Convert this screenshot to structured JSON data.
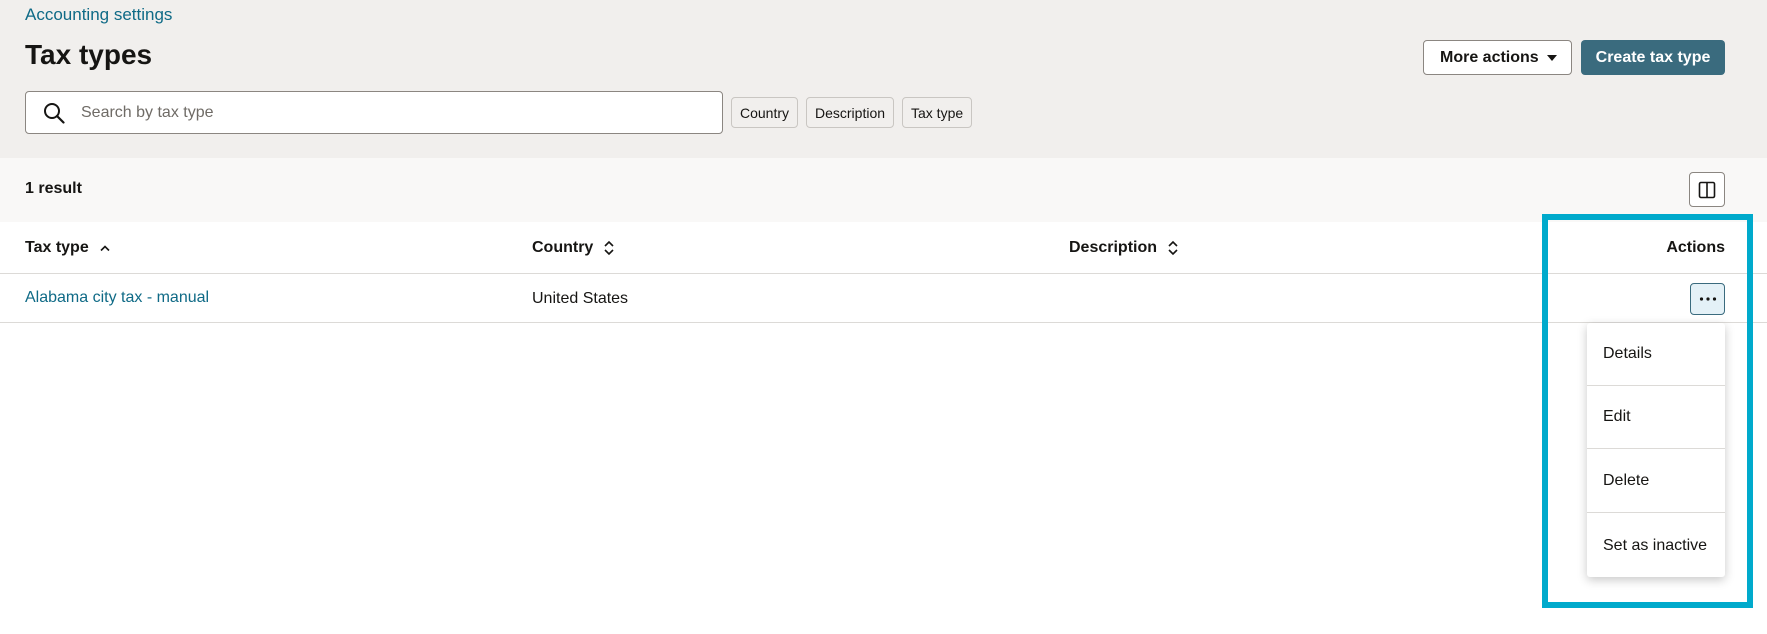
{
  "breadcrumb": "Accounting settings",
  "page_title": "Tax types",
  "header_actions": {
    "more_actions": "More actions",
    "create": "Create tax type"
  },
  "search": {
    "placeholder": "Search by tax type",
    "value": ""
  },
  "filter_chips": [
    "Country",
    "Description",
    "Tax type"
  ],
  "results": {
    "count_label": "1 result"
  },
  "table": {
    "columns": [
      "Tax type",
      "Country",
      "Description",
      "Actions"
    ],
    "rows": [
      {
        "tax_type": "Alabama city tax - manual",
        "country": "United States",
        "description": ""
      }
    ]
  },
  "row_menu": {
    "items": [
      "Details",
      "Edit",
      "Delete",
      "Set as inactive"
    ]
  },
  "colors": {
    "accent": "#3a6b7e",
    "link": "#0f6a86",
    "highlight": "#00aacc",
    "header_bg": "#f1efed"
  },
  "icons": [
    "search-icon",
    "caret-down-icon",
    "column-layout-icon",
    "sort-ascending-icon",
    "sort-icon",
    "more-icon"
  ]
}
